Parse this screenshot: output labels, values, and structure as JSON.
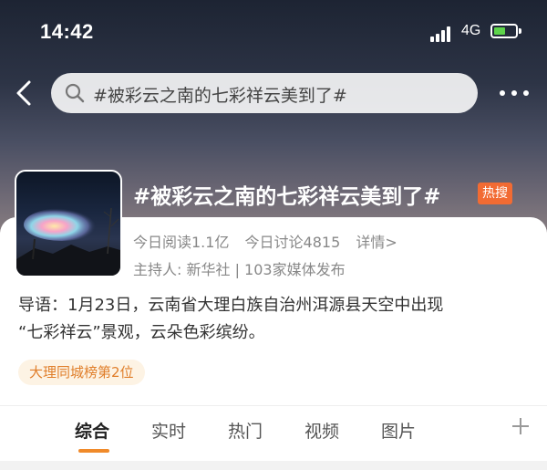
{
  "status_bar": {
    "time": "14:42",
    "network": "4G"
  },
  "search": {
    "query": "#被彩云之南的七彩祥云美到了#"
  },
  "topic": {
    "title": "#被彩云之南的七彩祥云美到了#",
    "hot_badge": "热搜",
    "reads": "今日阅读1.1亿",
    "discussions": "今日讨论4815",
    "details_link": "详情>",
    "host_line": "主持人: 新华社 | 103家媒体发布",
    "intro_line1": "导语：1月23日，云南省大理白族自治州洱源县天空中出现",
    "intro_line2": "“七彩祥云”景观，云朵色彩缤纷。",
    "rank_tag": "大理同城榜第2位"
  },
  "tabs": [
    {
      "label": "综合"
    },
    {
      "label": "实时"
    },
    {
      "label": "热门"
    },
    {
      "label": "视频"
    },
    {
      "label": "图片"
    }
  ],
  "colors": {
    "accent": "#f08a2a",
    "hot_badge": "#f26b33",
    "rank_tag_bg": "#fdf3e4"
  },
  "icons": [
    "back-arrow-icon",
    "search-icon",
    "more-dots-icon",
    "plus-icon",
    "battery-icon",
    "signal-icon"
  ]
}
